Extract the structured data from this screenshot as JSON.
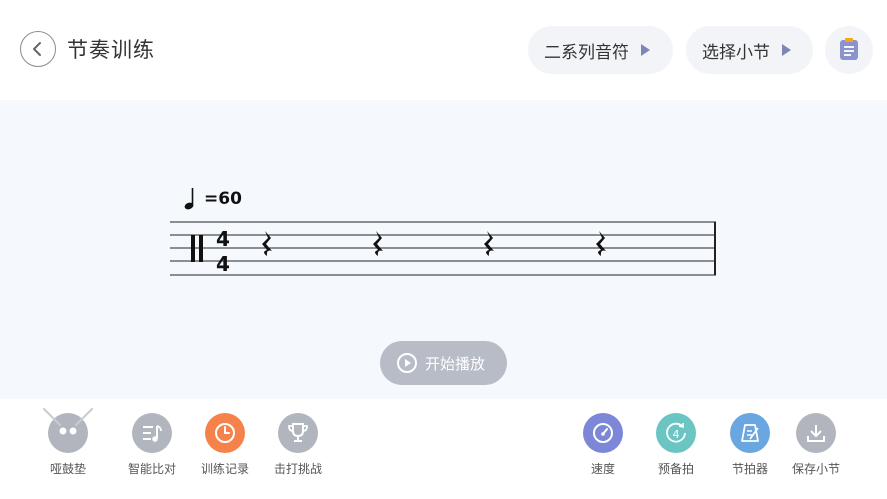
{
  "header": {
    "title": "节奏训练",
    "notes_pill": "二系列音符",
    "bars_pill": "选择小节"
  },
  "score": {
    "tempo": "=60",
    "time_signature_top": "4",
    "time_signature_bottom": "4",
    "play_label": "开始播放"
  },
  "toolbar": {
    "left": [
      {
        "label": "哑鼓垫",
        "color": "#b1b5bd",
        "icon": "drum-pad-icon"
      },
      {
        "label": "智能比对",
        "color": "#b1b5bd",
        "icon": "music-compare-icon"
      },
      {
        "label": "训练记录",
        "color": "#f5824a",
        "icon": "clock-icon"
      },
      {
        "label": "击打挑战",
        "color": "#b1b5bd",
        "icon": "trophy-icon"
      }
    ],
    "right": [
      {
        "label": "速度",
        "color": "#7d87d8",
        "icon": "speedometer-icon"
      },
      {
        "label": "预备拍",
        "color": "#6bc6c3",
        "icon": "countdown-icon"
      },
      {
        "label": "节拍器",
        "color": "#6aa6e0",
        "icon": "metronome-icon"
      },
      {
        "label": "保存小节",
        "color": "#b1b5bd",
        "icon": "download-icon"
      }
    ]
  }
}
